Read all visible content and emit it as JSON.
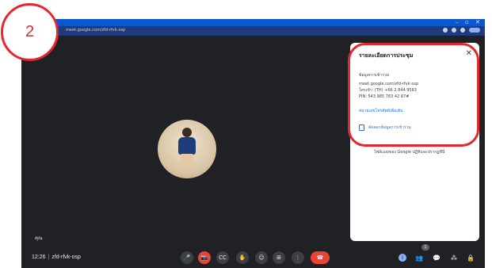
{
  "annotation": {
    "step_number": "2"
  },
  "browser": {
    "window_controls": [
      "–",
      "▫",
      "✕"
    ],
    "address_bar_url": "meet.google.com/zfd-rfvk-osp"
  },
  "meeting": {
    "self_name_tag": "คุณ",
    "time": "12:26",
    "separator": "|",
    "code": "zfd-rfvk-osp"
  },
  "info_panel": {
    "title": "รายละเอียดการประชุม",
    "close_glyph": "✕",
    "joining_label": "ข้อมูลการเข้าร่วม",
    "link": "meet.google.com/zfd-rfvk-osp",
    "phone": "โทรเข้า: (TH) +66 2 844 9583",
    "pin": "PIN: 543 985 763 42 87#",
    "more_numbers": "หมายเลขโทรศัพท์เพิ่มเติม",
    "copy_label": "คัดลอกข้อมูลการเข้าร่วม",
    "footer_note": "ไฟล์แนบของ Google ปฏิทินจะปรากฏที่นี่"
  },
  "controls": {
    "mic_glyph": "🎤",
    "camera_glyph": "📷",
    "captions_glyph": "CC",
    "hand_glyph": "✋",
    "emoji_glyph": "☺",
    "present_glyph": "⊞",
    "more_glyph": "⋮",
    "end_call_glyph": "☎",
    "info_glyph": "i",
    "people_glyph": "👥",
    "chat_glyph": "💬",
    "activities_glyph": "⁂",
    "host_glyph": "🔒",
    "people_count": "1"
  },
  "colors": {
    "annotation_red": "#e6262d",
    "chrome_blue": "#0b57d0",
    "meet_background": "#202124",
    "end_call_red": "#ea4335",
    "link_blue": "#1a73e8"
  }
}
